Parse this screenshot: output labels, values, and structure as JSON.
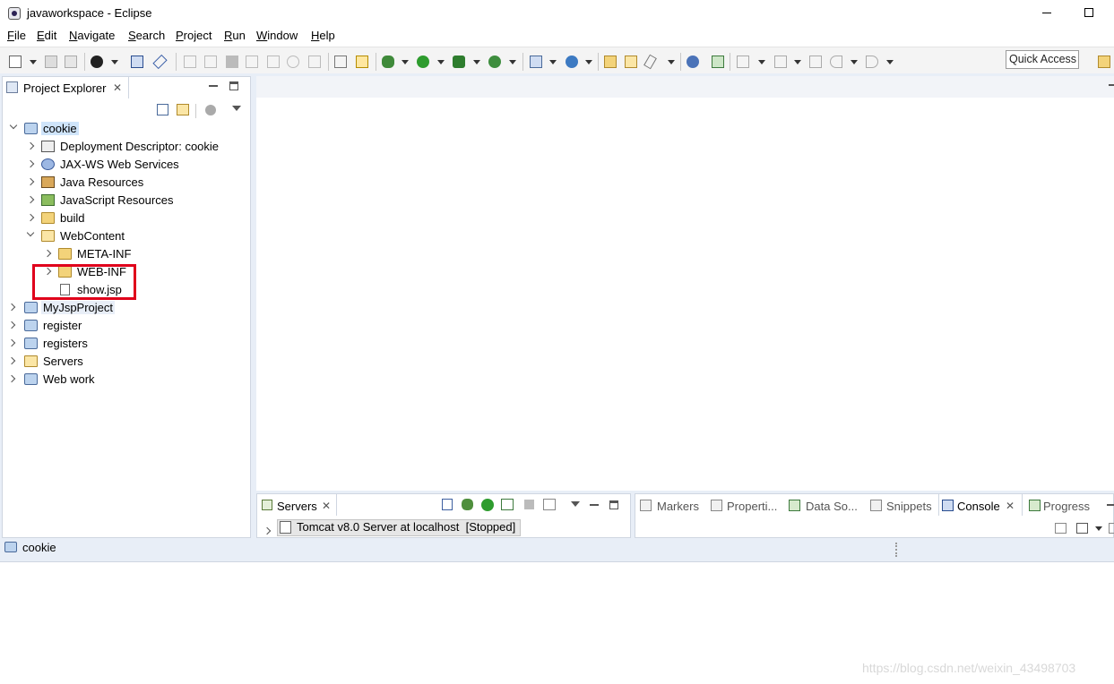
{
  "window": {
    "title": "javaworkspace - Eclipse"
  },
  "menu": [
    {
      "mnemonic": "F",
      "rest": "ile"
    },
    {
      "mnemonic": "E",
      "rest": "dit"
    },
    {
      "mnemonic": "N",
      "rest": "avigate"
    },
    {
      "mnemonic": "S",
      "rest": "earch"
    },
    {
      "mnemonic": "P",
      "rest": "roject"
    },
    {
      "mnemonic": "R",
      "rest": "un"
    },
    {
      "mnemonic": "W",
      "rest": "indow"
    },
    {
      "mnemonic": "H",
      "rest": "elp"
    }
  ],
  "toolbar": {
    "quick_access": "Quick Access"
  },
  "project_explorer": {
    "tab_label": "Project Explorer",
    "tree": [
      {
        "label": "cookie",
        "icon": "project-icon",
        "state": "open",
        "selected": true
      },
      {
        "label": "Deployment Descriptor: cookie",
        "icon": "deployment-descriptor-icon",
        "state": "closed"
      },
      {
        "label": "JAX-WS Web Services",
        "icon": "web-services-icon",
        "state": "closed"
      },
      {
        "label": "Java Resources",
        "icon": "java-resources-icon",
        "state": "closed"
      },
      {
        "label": "JavaScript Resources",
        "icon": "javascript-resources-icon",
        "state": "closed"
      },
      {
        "label": "build",
        "icon": "folder-icon",
        "state": "closed"
      },
      {
        "label": "WebContent",
        "icon": "folder-open-icon",
        "state": "open"
      },
      {
        "label": "META-INF",
        "icon": "folder-icon",
        "state": "closed"
      },
      {
        "label": "WEB-INF",
        "icon": "folder-icon",
        "state": "closed"
      },
      {
        "label": "show.jsp",
        "icon": "jsp-file-icon",
        "state": "none"
      },
      {
        "label": "MyJspProject",
        "icon": "project-icon",
        "state": "closed"
      },
      {
        "label": "register",
        "icon": "project-icon",
        "state": "closed"
      },
      {
        "label": "registers",
        "icon": "project-icon",
        "state": "closed"
      },
      {
        "label": "Servers",
        "icon": "folder-icon",
        "state": "closed"
      },
      {
        "label": "Web work",
        "icon": "web-project-icon",
        "state": "closed"
      }
    ]
  },
  "servers": {
    "tab_label": "Servers",
    "entry": "Tomcat v8.0 Server at localhost  [Stopped]"
  },
  "bottom_tabs": {
    "markers": "Markers",
    "properties": "Properti...",
    "data_source": "Data So...",
    "snippets": "Snippets",
    "console": "Console",
    "progress": "Progress"
  },
  "status": {
    "selected_item": "cookie"
  },
  "watermark": "https://blog.csdn.net/weixin_43498703",
  "colors": {
    "highlight": "#e0001b",
    "selection": "#cfe4fa",
    "workbench": "#e8eef7"
  }
}
